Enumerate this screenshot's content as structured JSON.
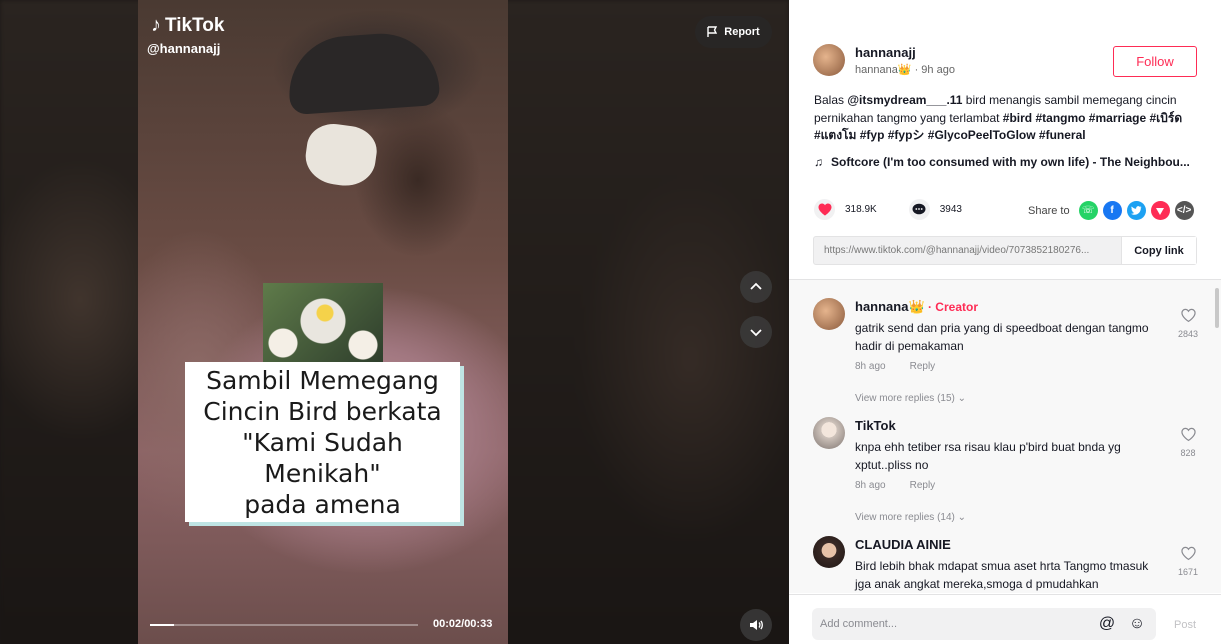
{
  "video": {
    "logo_text": "TikTok",
    "handle": "@hannanajj",
    "report_label": "Report",
    "caption": "Sambil Memegang\nCincin Bird berkata\n\"Kami Sudah Menikah\"\npada amena",
    "time": "00:02/00:33",
    "progress": 0.09
  },
  "author": {
    "username": "hannanajj",
    "subtitle": "hannana👑 · 9h ago",
    "follow_label": "Follow"
  },
  "description": {
    "prefix": "Balas ",
    "mention": "@itsmydream___.11",
    "text": " bird menangis sambil memegang cincin pernikahan tangmo yang terlambat ",
    "hashtags": "#bird #tangmo #marriage #เบิร์ด #แตงโม #fyp #fypシ #GlycoPeelToGlow #funeral"
  },
  "music": {
    "icon": "♫",
    "title": "Softcore (I'm too consumed with my own life) - The Neighbou..."
  },
  "stats": {
    "likes": "318.9K",
    "comments": "3943",
    "share_label": "Share to"
  },
  "link": {
    "url": "https://www.tiktok.com/@hannanajj/video/7073852180276...",
    "copy_label": "Copy link"
  },
  "comments": [
    {
      "name": "hannana👑",
      "badge": " · Creator",
      "text": "gatrik send dan pria yang di speedboat dengan tangmo hadir di pemakaman",
      "time": "8h ago",
      "reply": "Reply",
      "likes": "2843",
      "more": "View more replies (15)"
    },
    {
      "name": "TikTok",
      "badge": "",
      "text": "knpa ehh tetiber rsa risau klau p'bird buat bnda yg xptut..pliss no",
      "time": "8h ago",
      "reply": "Reply",
      "likes": "828",
      "more": "View more replies (14)"
    },
    {
      "name": "CLAUDIA AINIE",
      "badge": "",
      "text": "Bird lebih bhak mdapat smua aset hrta Tangmo tmasuk jga anak angkat mereka,smoga d pmudahkan",
      "time": "",
      "reply": "",
      "likes": "1671",
      "more": ""
    }
  ],
  "comment_box": {
    "placeholder": "Add comment...",
    "post_label": "Post"
  },
  "colors": {
    "accent": "#fe2c55",
    "whatsapp": "#25d366",
    "facebook": "#1877f2",
    "twitter": "#1da1f2",
    "send": "#fe2c55",
    "embed": "#161823"
  }
}
